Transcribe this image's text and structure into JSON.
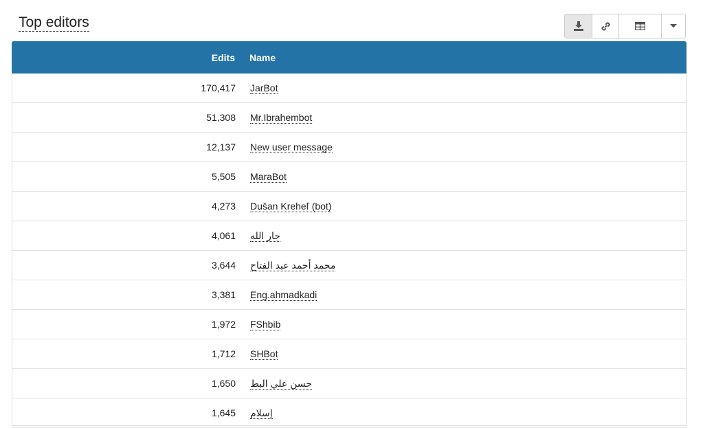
{
  "title": "Top editors",
  "toolbar": {
    "icons": [
      "download-icon",
      "link-icon",
      "table-icon",
      "caret-down-icon"
    ]
  },
  "table": {
    "headers": {
      "edits": "Edits",
      "name": "Name"
    },
    "rows": [
      {
        "edits": "170,417",
        "name": "JarBot"
      },
      {
        "edits": "51,308",
        "name": "Mr.Ibrahembot"
      },
      {
        "edits": "12,137",
        "name": "New user message"
      },
      {
        "edits": "5,505",
        "name": "MaraBot"
      },
      {
        "edits": "4,273",
        "name": "Dušan Kreheľ (bot)"
      },
      {
        "edits": "4,061",
        "name": "جار الله"
      },
      {
        "edits": "3,644",
        "name": "محمد أحمد عبد الفتاح"
      },
      {
        "edits": "3,381",
        "name": "Eng.ahmadkadi"
      },
      {
        "edits": "1,972",
        "name": "FShbib"
      },
      {
        "edits": "1,712",
        "name": "SHBot"
      },
      {
        "edits": "1,650",
        "name": "حسن علي البط"
      },
      {
        "edits": "1,645",
        "name": "إسلام"
      }
    ]
  },
  "colors": {
    "header_bg": "#2473a6",
    "header_text": "#ffffff",
    "active_button_bg": "#e6e6e6"
  }
}
